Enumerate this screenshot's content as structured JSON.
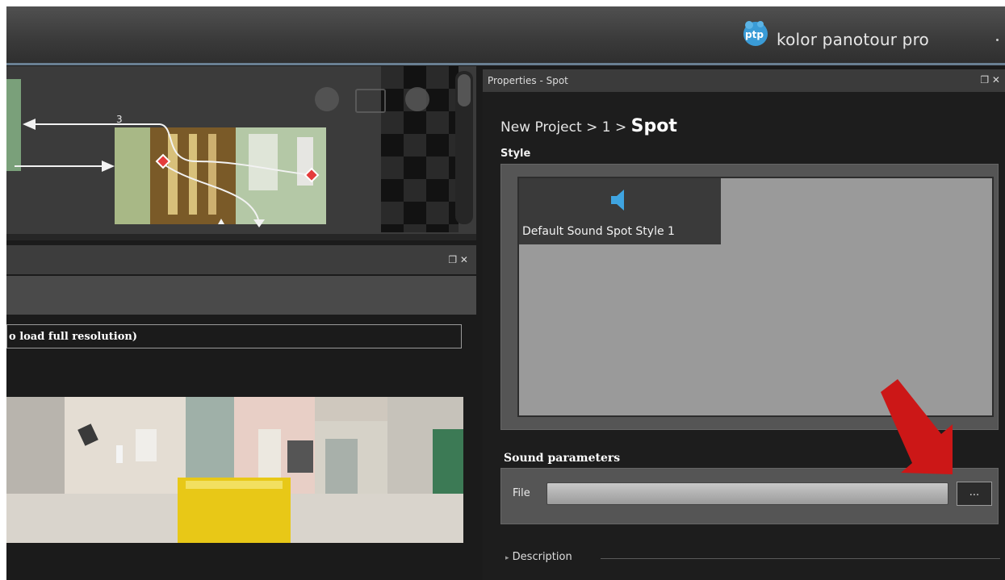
{
  "app": {
    "brand": "kolor panotour pro",
    "logo_text": "ptp"
  },
  "tour_map": {
    "node_label": "3",
    "icons": [
      "zoom-out-icon",
      "fit-view-icon",
      "zoom-in-icon"
    ]
  },
  "preview_panel": {
    "resolution_hint": "o load full resolution)"
  },
  "properties": {
    "title": "Properties - Spot",
    "breadcrumb": {
      "project": "New Project",
      "sep1": ">",
      "node": "1",
      "sep2": ">",
      "current": "Spot"
    },
    "style_label": "Style",
    "styles": [
      {
        "label": "Default Sound Spot Style 1",
        "icon": "speaker-icon",
        "selected": true
      }
    ],
    "sound_parameters": {
      "label": "Sound parameters",
      "file_label": "File",
      "file_value": "",
      "browse_label": "..."
    },
    "description_label": "Description"
  },
  "colors": {
    "accent_blue": "#4aa3d8",
    "arrow_red": "#cc1717",
    "topbar_line": "#6a7f92"
  }
}
